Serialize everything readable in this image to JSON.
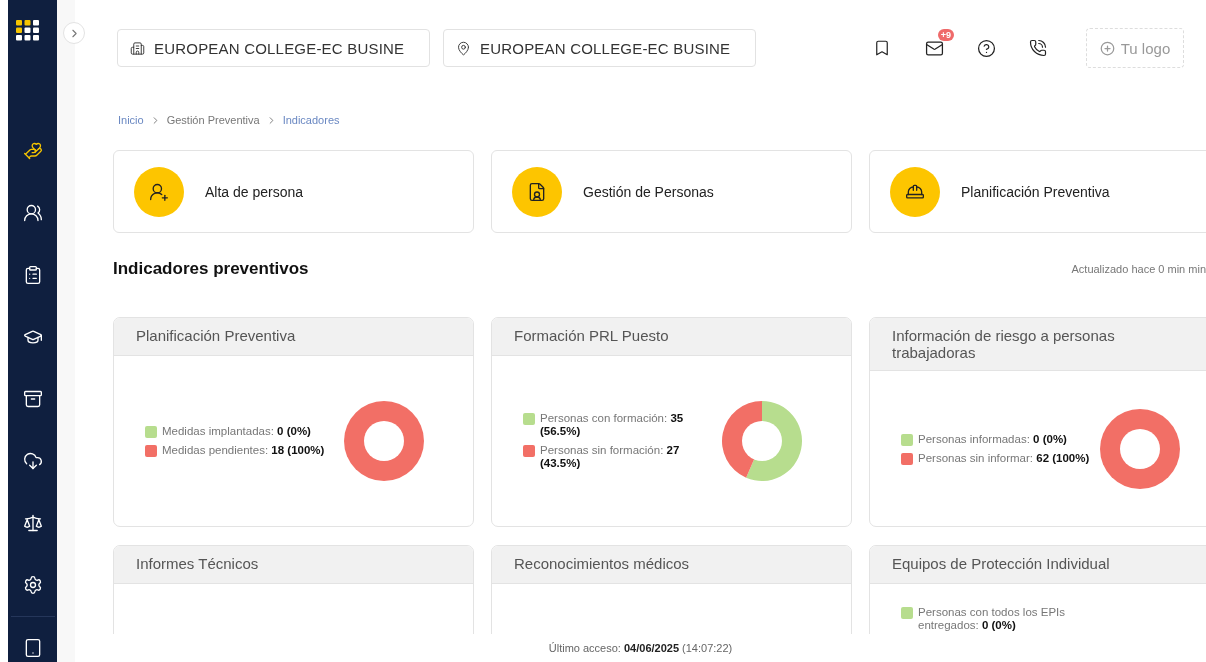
{
  "sidebar": {
    "items": [
      {
        "selected": true
      },
      {
        "selected": false
      },
      {
        "selected": false
      },
      {
        "selected": false
      },
      {
        "selected": false
      },
      {
        "selected": false
      },
      {
        "selected": false
      },
      {
        "selected": false
      },
      {
        "selected": false
      }
    ]
  },
  "header": {
    "company_field": {
      "value": "EUROPEAN COLLEGE-EC BUSINE"
    },
    "location_field": {
      "value": "EUROPEAN COLLEGE-EC BUSINE"
    },
    "mail_badge": "+9",
    "logo_button": "Tu logo"
  },
  "breadcrumb": [
    {
      "label": "Inicio",
      "kind": "link"
    },
    {
      "label": "Gestión Preventiva",
      "kind": "text"
    },
    {
      "label": "Indicadores",
      "kind": "link"
    }
  ],
  "shortcuts": [
    {
      "label": "Alta de persona"
    },
    {
      "label": "Gestión de Personas"
    },
    {
      "label": "Planificación Preventiva"
    }
  ],
  "section": {
    "title": "Indicadores preventivos",
    "updated": "Actualizado hace 0 min min"
  },
  "indicators": [
    {
      "title": "Planificación Preventiva",
      "legend": [
        {
          "text": "Medidas implantadas: **0 (0%)**",
          "color": "#b7dd8e"
        },
        {
          "text": "Medidas pendientes: **18 (100%)**",
          "color": "#f26f66"
        }
      ],
      "chart_data": {
        "type": "donut",
        "values": [
          0,
          100
        ]
      }
    },
    {
      "title": "Formación PRL Puesto",
      "legend": [
        {
          "text": "Personas con formación: **35 (56.5%)**",
          "color": "#b7dd8e"
        },
        {
          "text": "Personas sin formación: **27 (43.5%)**",
          "color": "#f26f66"
        }
      ],
      "chart_data": {
        "type": "donut",
        "values": [
          56.5,
          43.5
        ]
      }
    },
    {
      "title": "Información de riesgo a personas trabajadoras",
      "legend": [
        {
          "text": "Personas informadas: **0 (0%)**",
          "color": "#b7dd8e"
        },
        {
          "text": "Personas sin informar: **62 (100%)**",
          "color": "#f26f66"
        }
      ],
      "chart_data": {
        "type": "donut",
        "values": [
          0,
          100
        ]
      }
    },
    {
      "title": "Informes Técnicos"
    },
    {
      "title": "Reconocimientos médicos"
    },
    {
      "title": "Equipos de Protección Individual",
      "legend": [
        {
          "text": "Personas con todos los EPIs entregados: **0 (0%)**",
          "color": "#b7dd8e"
        }
      ]
    }
  ],
  "footer": {
    "last_access": "Último acceso: **04/06/2025** (14:07:22)"
  }
}
